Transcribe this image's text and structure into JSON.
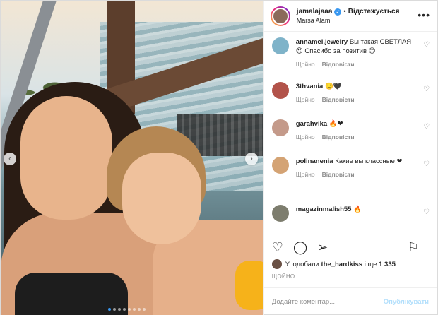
{
  "post": {
    "author": {
      "username": "jamalajaaa",
      "verified": true,
      "follow_status": "Відстежується",
      "location": "Marsa Alam"
    },
    "carousel": {
      "slide_count": 8,
      "active_index": 0
    }
  },
  "comments": [
    {
      "user": "annamel.jewelry",
      "text": "Вы такая СВЕТЛАЯ😍 Спасибо за позитив 😊",
      "time": "Щойно",
      "reply": "Відповісти",
      "avatar_color": "#7fb3c9"
    },
    {
      "user": "3thvania",
      "text": "🙂🖤",
      "time": "Щойно",
      "reply": "Відповісти",
      "avatar_color": "#b2534a"
    },
    {
      "user": "garahvika",
      "text": "🔥❤",
      "time": "Щойно",
      "reply": "Відповісти",
      "avatar_color": "#c49a8a"
    },
    {
      "user": "polinanenia",
      "text": "Какие вы классные ❤",
      "time": "Щойно",
      "reply": "Відповісти",
      "avatar_color": "#d4a374"
    },
    {
      "user": "magazinmalish55",
      "text": "🔥",
      "time": "",
      "reply": "",
      "avatar_color": "#7d7d6e"
    }
  ],
  "likes": {
    "prefix": "Уподобали",
    "user": "the_hardkiss",
    "suffix": "і ще",
    "count": "1 335"
  },
  "timeago": "ЩОЙНО",
  "add_comment": {
    "placeholder": "Додайте коментар...",
    "publish_label": "Опублікувати"
  },
  "colors": {
    "link_blue": "#3897f0",
    "publish_disabled": "#b2dffc",
    "muted": "#8e8e8e"
  }
}
